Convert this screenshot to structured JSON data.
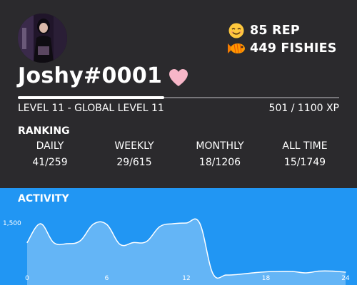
{
  "profile": {
    "username": "Joshy#0001",
    "rep": "85 REP",
    "fishies": "449 FISHIES",
    "rep_icon": "smiling-face-emoji",
    "fish_icon": "goldfish-emoji",
    "badge_icon": "pink-heart"
  },
  "level": {
    "text": "LEVEL 11 - GLOBAL LEVEL 11",
    "xp_text": "501 / 1100 XP",
    "progress": 0.455
  },
  "ranking": {
    "title": "RANKING",
    "columns": [
      {
        "label": "DAILY",
        "value": "41/259"
      },
      {
        "label": "WEEKLY",
        "value": "29/615"
      },
      {
        "label": "MONTHLY",
        "value": "18/1206"
      },
      {
        "label": "ALL TIME",
        "value": "15/1749"
      }
    ]
  },
  "activity": {
    "title": "ACTIVITY"
  },
  "colors": {
    "card_bg": "#2b2a2d",
    "activity_bg": "#2196f3",
    "area_fill": "#64b5f6",
    "heart": "#f7b6c8"
  },
  "chart_data": {
    "type": "area",
    "x": [
      0,
      1,
      2,
      3,
      4,
      5,
      6,
      7,
      8,
      9,
      10,
      11,
      12,
      13,
      14,
      15,
      16,
      17,
      18,
      19,
      20,
      21,
      22,
      23,
      24
    ],
    "values": [
      950,
      1480,
      950,
      920,
      1000,
      1470,
      1460,
      900,
      950,
      980,
      1400,
      1480,
      1500,
      1500,
      80,
      40,
      60,
      100,
      130,
      140,
      140,
      100,
      150,
      150,
      120
    ],
    "x_ticks": [
      "0",
      "6",
      "12",
      "18",
      "24"
    ],
    "y_ticks": [
      "1,500"
    ],
    "ylim": [
      0,
      2000
    ],
    "xlim": [
      0,
      24
    ],
    "grid": false
  }
}
